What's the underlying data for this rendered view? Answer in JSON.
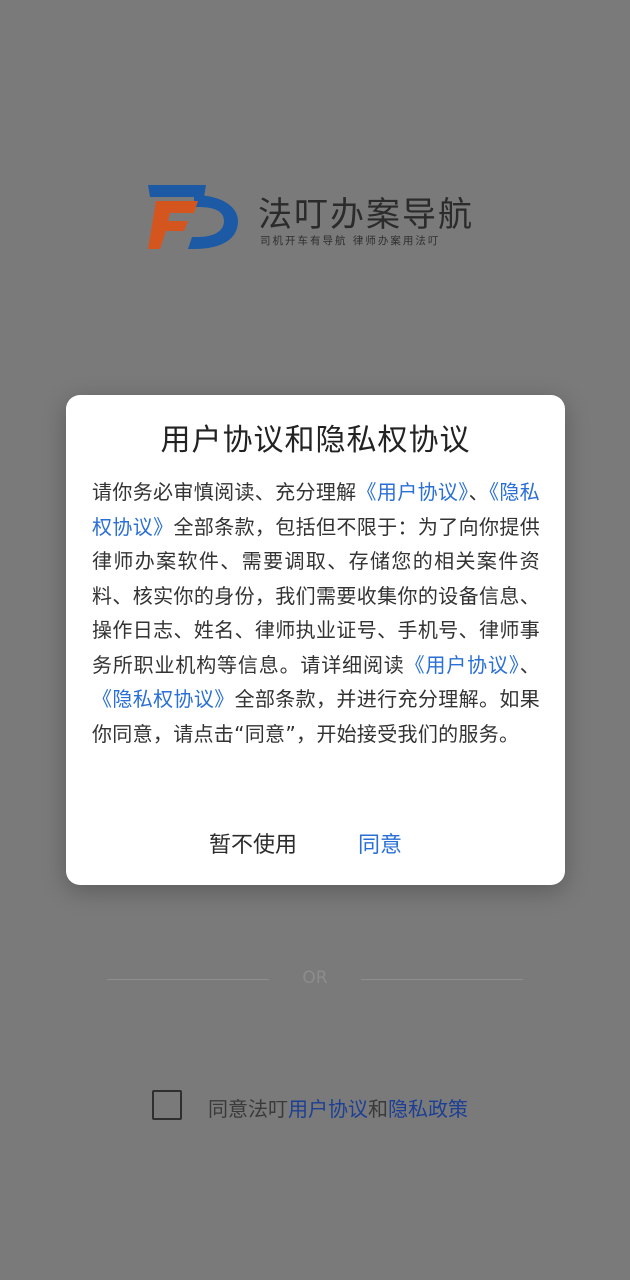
{
  "brand": {
    "name": "法叮办案导航",
    "slogan": "司机开车有导航   律师办案用法叮",
    "colors": {
      "blue": "#1c5aa6",
      "orange": "#d4561e"
    }
  },
  "divider": {
    "text": "OR"
  },
  "agreement": {
    "prefix": "同意法叮",
    "user_agreement": "用户协议",
    "and": "和",
    "privacy_policy": "隐私政策"
  },
  "dialog": {
    "title": "用户协议和隐私权协议",
    "body": {
      "p1": "请你务必审慎阅读、充分理解",
      "link_user1": "《用户协议》",
      "p2": "、",
      "link_privacy1": "《隐私权协议》",
      "p3": "全部条款，包括但不限于：为了向你提供律师办案软件、需要调取、存储您的相关案件资料、核实你的身份，我们需要收集你的设备信息、操作日志、姓名、律师执业证号、手机号、律师事务所职业机构等信息。请详细阅读",
      "link_user2": "《用户协议》",
      "p4": "、",
      "link_privacy2": "《隐私权协议》",
      "p5": "全部条款，并进行充分理解。如果你同意，请点击“同意”，开始接受我们的服务。"
    },
    "decline_label": "暂不使用",
    "accept_label": "同意"
  },
  "colors": {
    "overlay_background": "#7a7a7a",
    "link": "#2a6fd6",
    "agreement_link": "#1c3f94"
  }
}
